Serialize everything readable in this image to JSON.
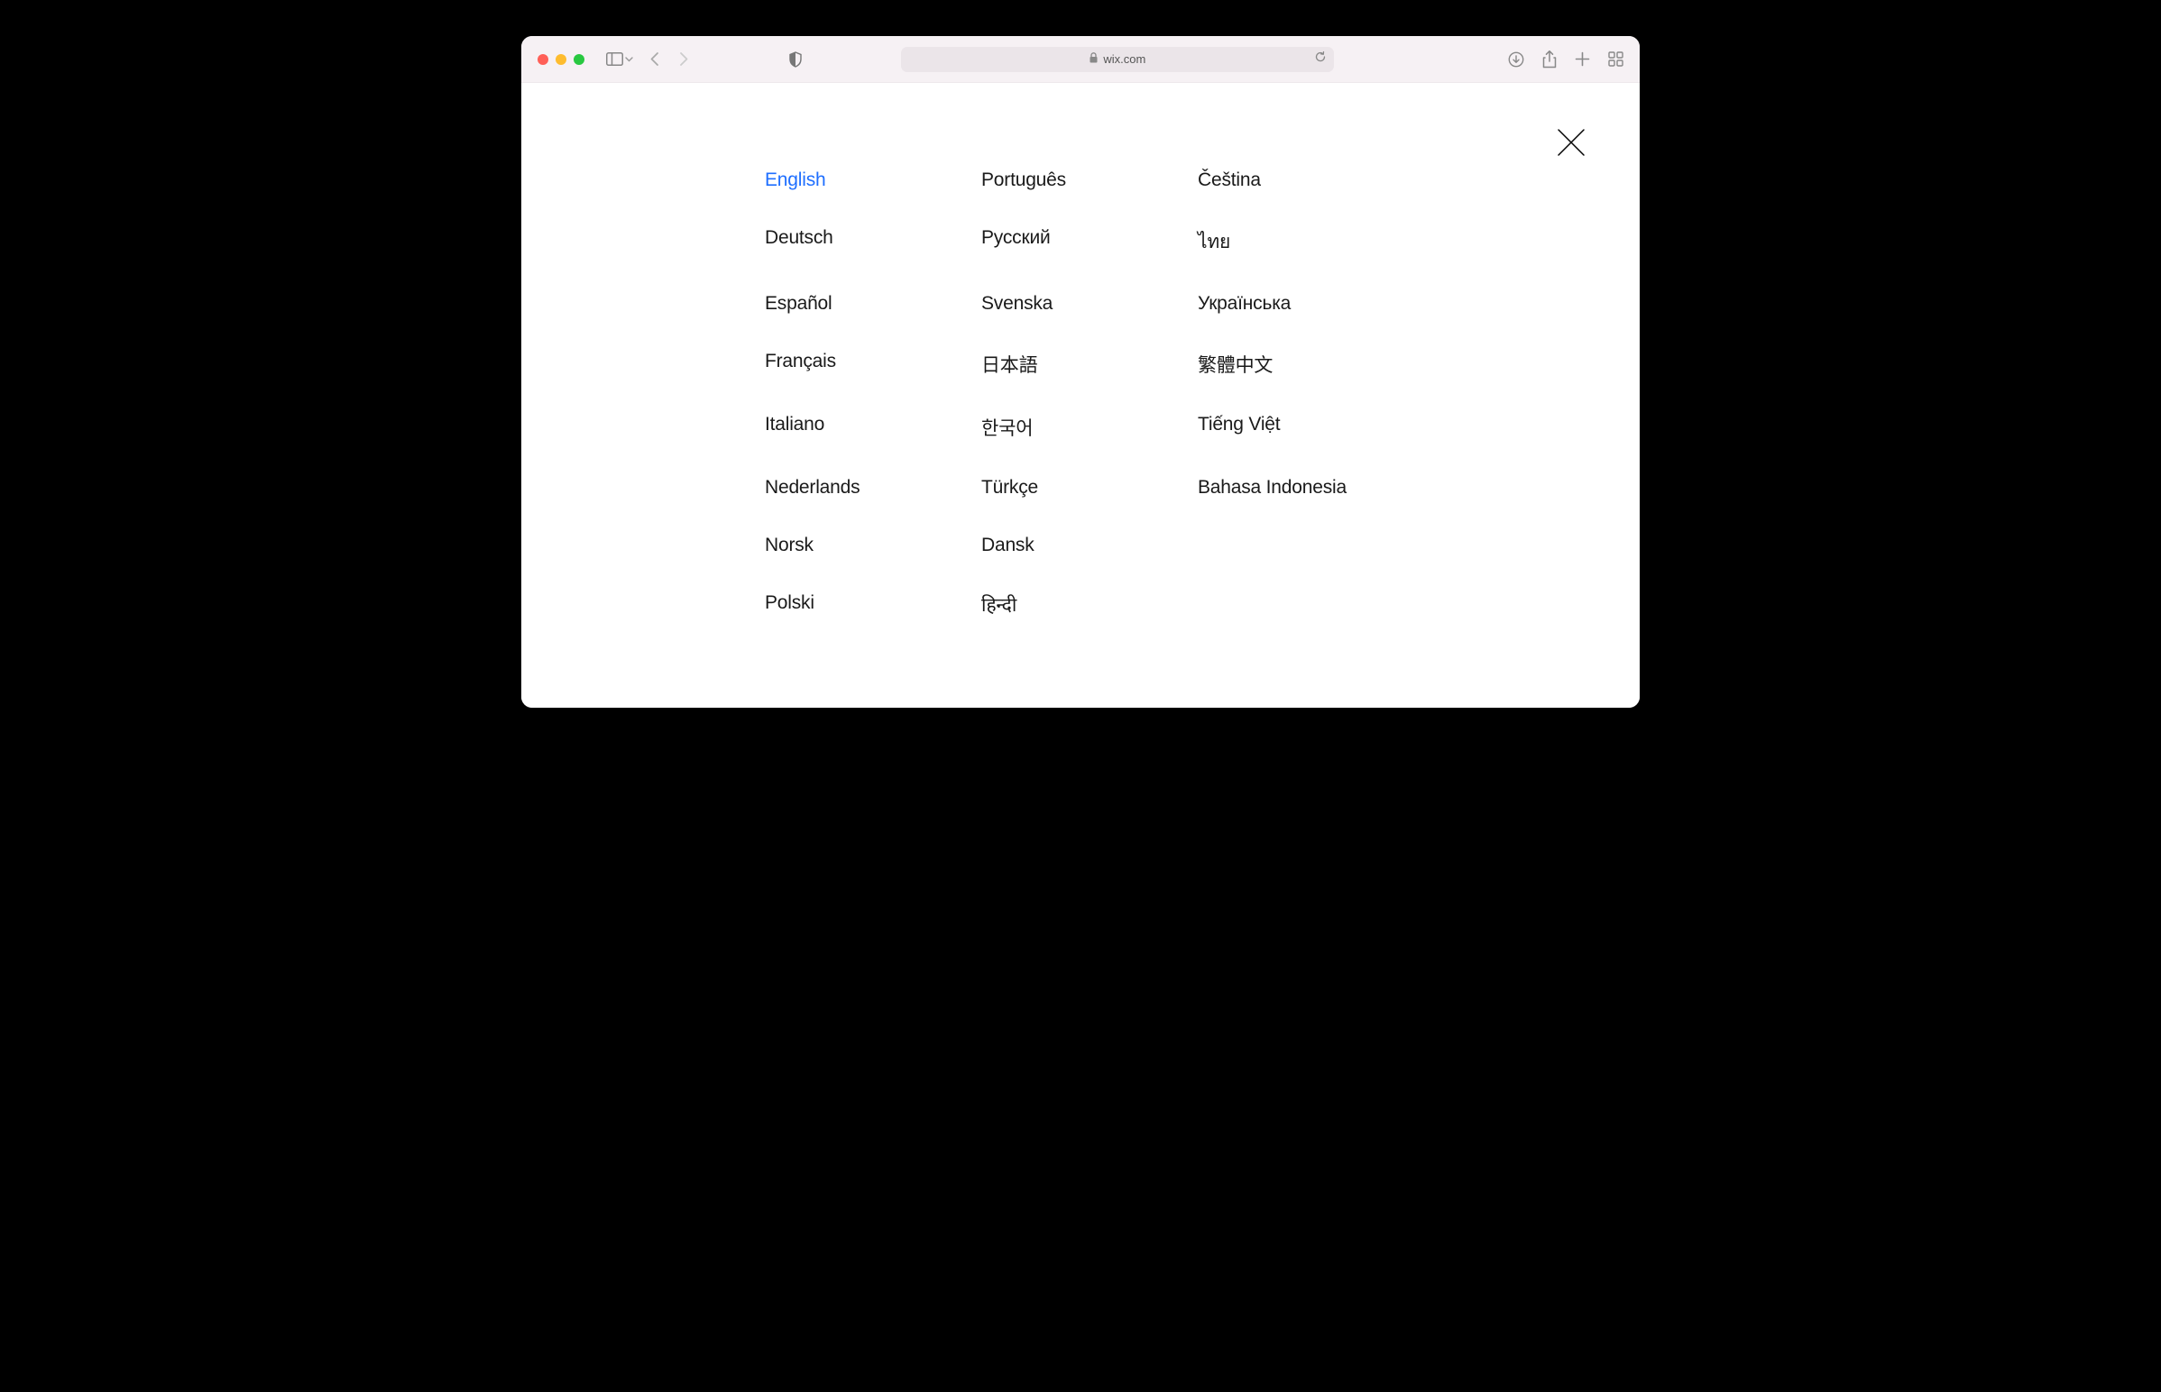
{
  "browser": {
    "domain": "wix.com"
  },
  "modal": {
    "selected_language": "English",
    "columns": [
      [
        "English",
        "Deutsch",
        "Español",
        "Français",
        "Italiano",
        "Nederlands",
        "Norsk",
        "Polski"
      ],
      [
        "Português",
        "Русский",
        "Svenska",
        "日本語",
        "한국어",
        "Türkçe",
        "Dansk",
        "हिन्दी"
      ],
      [
        "Čeština",
        "ไทย",
        "Українська",
        "繁體中文",
        "Tiếng Việt",
        "Bahasa Indonesia"
      ]
    ]
  }
}
